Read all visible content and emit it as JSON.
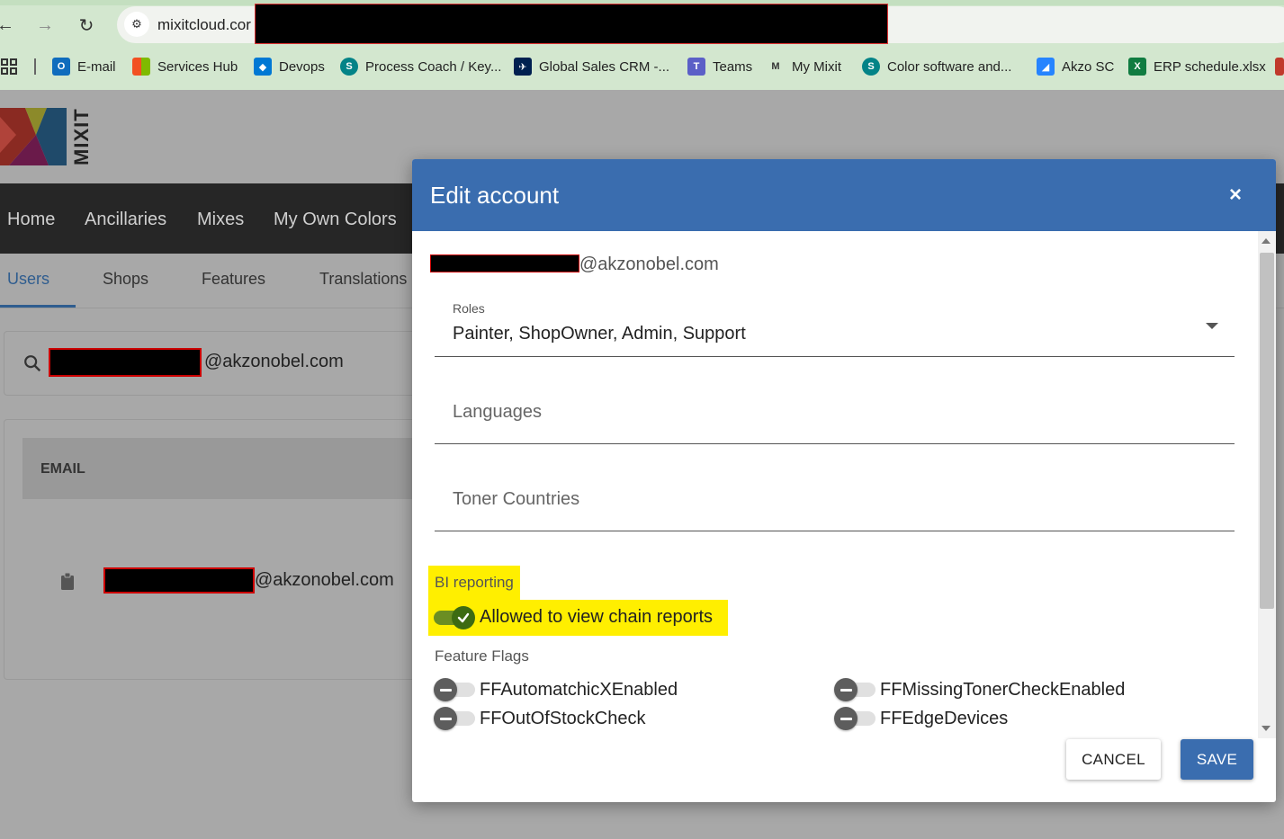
{
  "browser": {
    "url_visible": "mixitcloud.cor",
    "bookmarks": [
      {
        "label": "E-mail",
        "icon": "outlook-icon",
        "color": "#0f6cbd"
      },
      {
        "label": "Services Hub",
        "icon": "microsoft-icon",
        "color": "#f25022"
      },
      {
        "label": "Devops",
        "icon": "azure-devops-icon",
        "color": "#0078d4"
      },
      {
        "label": "Process Coach / Key...",
        "icon": "sharepoint-icon",
        "color": "#038387"
      },
      {
        "label": "Global Sales CRM -...",
        "icon": "crm-icon",
        "color": "#002050"
      },
      {
        "label": "Teams",
        "icon": "teams-icon",
        "color": "#5b5fc7"
      },
      {
        "label": "My Mixit",
        "icon": "mixit-icon",
        "color": "#333333"
      },
      {
        "label": "Color software and...",
        "icon": "sharepoint-icon",
        "color": "#038387"
      },
      {
        "label": "Akzo SC",
        "icon": "jira-icon",
        "color": "#2684ff"
      },
      {
        "label": "ERP schedule.xlsx",
        "icon": "excel-icon",
        "color": "#107c41"
      }
    ]
  },
  "app": {
    "logo_text": "MIXIT",
    "nav": [
      "Home",
      "Ancillaries",
      "Mixes",
      "My Own Colors"
    ],
    "subnav": [
      "Users",
      "Shops",
      "Features",
      "Translations"
    ],
    "search_value_suffix": "@akzonobel.com",
    "table": {
      "email_header": "EMAIL",
      "row_email_suffix": "@akzonobel.com"
    }
  },
  "modal": {
    "title": "Edit account",
    "close_label": "×",
    "email_suffix": "@akzonobel.com",
    "roles": {
      "label": "Roles",
      "value": "Painter, ShopOwner, Admin, Support"
    },
    "languages": {
      "placeholder": "Languages"
    },
    "toner_countries": {
      "placeholder": "Toner Countries"
    },
    "bi_reporting": {
      "label": "BI reporting",
      "toggle_label": "Allowed to view chain reports",
      "checked": true
    },
    "feature_flags": {
      "title": "Feature Flags",
      "flags": [
        {
          "label": "FFAutomatchicXEnabled",
          "checked": false
        },
        {
          "label": "FFMissingTonerCheckEnabled",
          "checked": false
        },
        {
          "label": "FFOutOfStockCheck",
          "checked": false
        },
        {
          "label": "FFEdgeDevices",
          "checked": false
        }
      ]
    },
    "cancel_label": "CANCEL",
    "save_label": "SAVE"
  },
  "colors": {
    "modal_header": "#3a6daf",
    "highlight": "#ffef00",
    "toggle_on": "#3d6b12"
  }
}
